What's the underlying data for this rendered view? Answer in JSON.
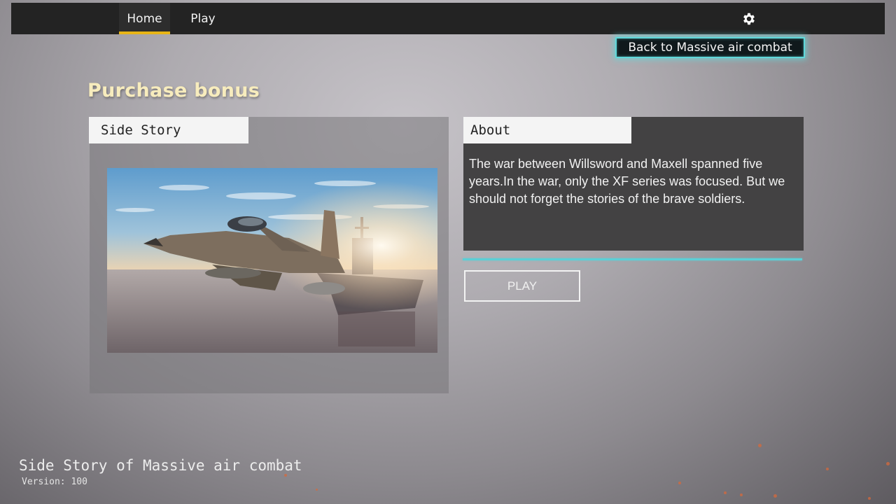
{
  "nav": {
    "tabs": [
      {
        "label": "Home",
        "active": true
      },
      {
        "label": "Play",
        "active": false
      }
    ],
    "settings_icon": "gear-icon",
    "active_indicator_color": "#e7b416"
  },
  "back_button": {
    "label": "Back to Massive air combat"
  },
  "page_title": "Purchase bonus",
  "side_story": {
    "tab_label": "Side Story",
    "image": "fighter-jet-over-carrier-at-sunset"
  },
  "about": {
    "tab_label": "About",
    "text": "The war between Willsword and Maxell spanned five years.In the war, only the XF series was focused. But we should not forget the stories of the brave soldiers."
  },
  "play_button": {
    "label": "PLAY"
  },
  "footer": {
    "title": "Side Story of Massive air combat",
    "version": "Version: 100"
  },
  "colors": {
    "accent_cyan": "#5ccfd6",
    "title_cream": "#f7ecbd",
    "nav_bg": "#232323"
  }
}
